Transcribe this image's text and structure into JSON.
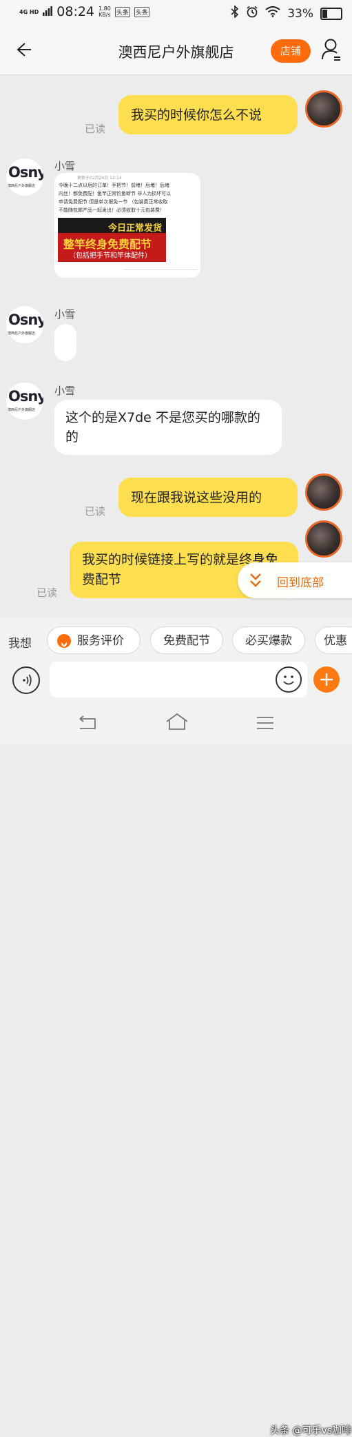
{
  "status_bar": {
    "network": "4G HD",
    "time": "08:24",
    "speed_value": "1.80",
    "speed_unit": "KB/s",
    "badge_1": "头条",
    "badge_2": "头条",
    "battery": "33%",
    "battery_level": 0.33
  },
  "header": {
    "title": "澳西尼户外旗舰店",
    "shop_button": "店铺"
  },
  "messages": [
    {
      "side": "right",
      "text": "我买的时候你怎么不说",
      "status": "已读"
    },
    {
      "side": "left",
      "sender": "小雪",
      "type": "image",
      "image": {
        "timestamp": "更新于02月24日 12:14",
        "lines": [
          "今晚十二点以后的订单！手把节！前堵！后堵！后堵",
          "内丝！都免费配！鱼竿正常钓鱼断节 非人为损坏可以",
          "申请免费配节 但是单次限免一节 （包装费正常收取",
          "不能随包邮产品一起发出！必须收取十元包装费！"
        ],
        "banner_top": "今日正常发货",
        "banner_main": "整竿终身免费配节",
        "banner_sub": "（包括把手节和竿体配件）"
      }
    },
    {
      "side": "left",
      "sender": "小雪",
      "text": ""
    },
    {
      "side": "left",
      "sender": "小雪",
      "text": "这个的是X7de 不是您买的哪款的的"
    },
    {
      "side": "right",
      "text": "现在跟我说这些没用的",
      "status": "已读"
    },
    {
      "side": "right",
      "text": "我买的时候链接上写的就是终身免费配节",
      "status": "已读"
    }
  ],
  "shop_avatar_text": {
    "logo": "Osny",
    "sub": "澳西尼户外旗舰店"
  },
  "scroll_to_bottom": "回到底部",
  "quick_replies": {
    "label": "我想",
    "items": [
      "服务评价",
      "免费配节",
      "必买爆款",
      "优惠"
    ]
  },
  "input": {
    "placeholder": ""
  },
  "watermark": "头条 @可乐vs咖啡",
  "colors": {
    "accent": "#ff6a0b",
    "bubble_mine": "#fcde4f",
    "bubble_theirs": "#ffffff",
    "background": "#ececec"
  }
}
